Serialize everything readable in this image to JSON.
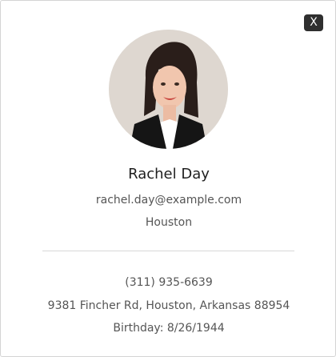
{
  "dialog": {
    "close_label": "X"
  },
  "profile": {
    "avatar_icon": "profile-photo",
    "name": "Rachel Day",
    "email": "rachel.day@example.com",
    "city": "Houston",
    "phone": "(311) 935-6639",
    "address": "9381 Fincher Rd, Houston, Arkansas 88954",
    "birthday": "Birthday: 8/26/1944"
  }
}
